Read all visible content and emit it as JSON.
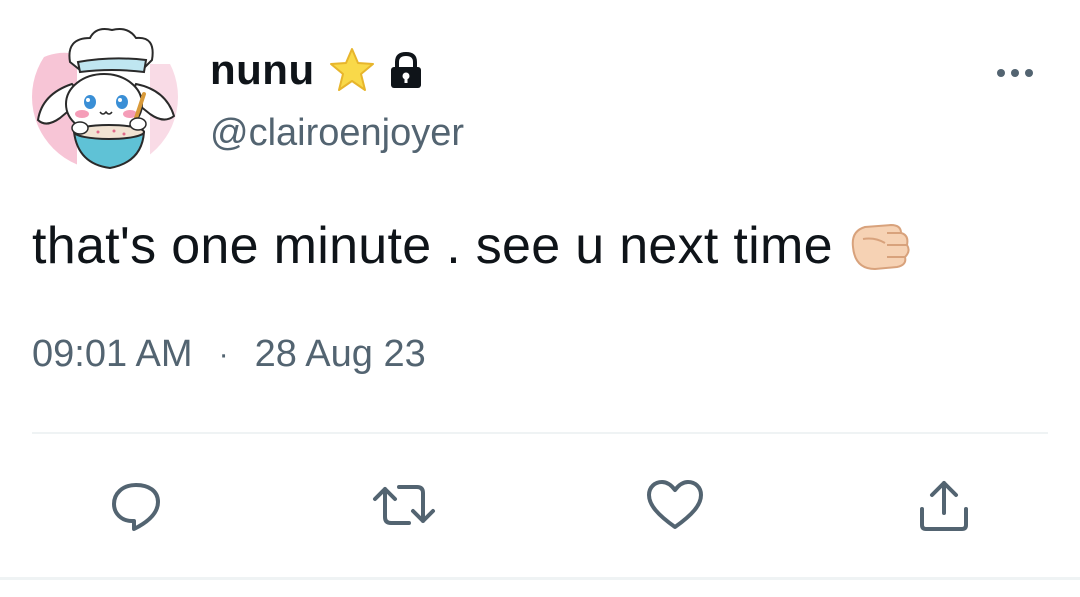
{
  "tweet": {
    "display_name": "nunu",
    "handle": "@clairoenjoyer",
    "text": "that's one minute . see u next time",
    "time": "09:01 AM",
    "separator": "·",
    "date": "28 Aug 23"
  },
  "icons": {
    "avatar": "cinnamoroll-chef-avatar",
    "badge": "star-icon",
    "protected": "lock-icon",
    "menu": "more-icon",
    "emoji": "pointing-fist-icon",
    "reply": "reply-icon",
    "retweet": "retweet-icon",
    "like": "heart-icon",
    "share": "share-icon"
  },
  "colors": {
    "text": "#0f1419",
    "secondary": "#536471",
    "divider": "#eff3f4",
    "star": "#f9d949"
  }
}
